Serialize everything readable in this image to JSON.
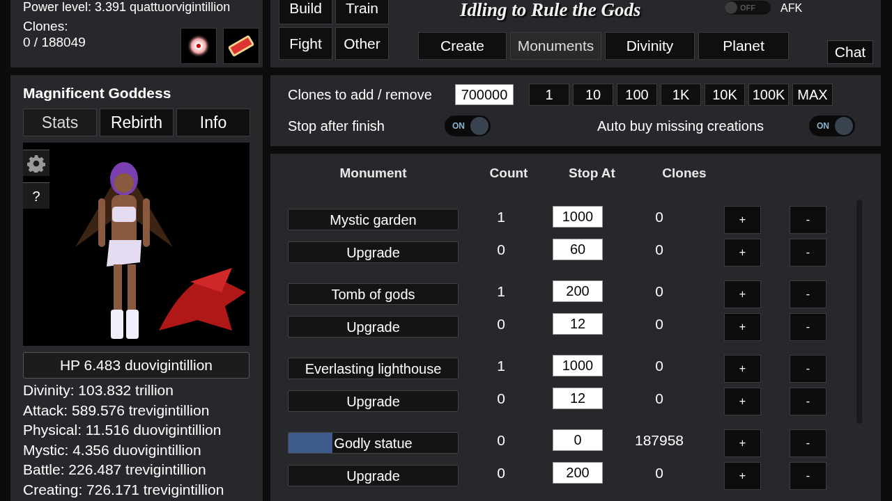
{
  "player": {
    "power_level": "Power level: 3.391 quattuorvigintillion",
    "clones_label": "Clones:",
    "clones_value": "0 / 188049"
  },
  "nav_buttons": [
    {
      "label": "Build"
    },
    {
      "label": "Train"
    },
    {
      "label": "Fight"
    },
    {
      "label": "Other"
    }
  ],
  "game_title": "Idling to Rule the Gods",
  "afk": {
    "toggle_text": "OFF",
    "on": false,
    "label": "AFK"
  },
  "tabs": [
    {
      "label": "Create",
      "selected": false
    },
    {
      "label": "Monuments",
      "selected": true
    },
    {
      "label": "Divinity",
      "selected": false
    },
    {
      "label": "Planet",
      "selected": false
    }
  ],
  "chat_button": "Chat",
  "character": {
    "name": "Magnificent Goddess",
    "tabs": [
      {
        "label": "Stats",
        "selected": true
      },
      {
        "label": "Rebirth",
        "selected": false
      },
      {
        "label": "Info",
        "selected": false
      }
    ],
    "help_button": "?",
    "hp": "HP 6.483 duovigintillion",
    "stats": [
      "Divinity: 103.832 trillion",
      "Attack: 589.576 trevigintillion",
      "Physical: 11.516 duovigintillion",
      "Mystic: 4.356 duovigintillion",
      "Battle: 226.487 trevigintillion",
      "Creating: 726.171 trevigintillion"
    ]
  },
  "options": {
    "clones_label": "Clones to add / remove",
    "clones_value": "700000",
    "amount_buttons": [
      "1",
      "10",
      "100",
      "1K",
      "10K",
      "100K",
      "MAX"
    ],
    "toggles": [
      {
        "label": "Stop after finish",
        "text": "ON",
        "on": true
      },
      {
        "label": "Auto buy missing creations",
        "text": "ON",
        "on": true
      }
    ]
  },
  "table": {
    "columns": [
      "Monument",
      "Count",
      "Stop At",
      "Clones"
    ],
    "groups": [
      {
        "rows": [
          {
            "name": "Mystic garden",
            "count": "1",
            "stop_at": "1000",
            "clones": "0",
            "plus": "+",
            "minus": "-"
          },
          {
            "name": "Upgrade",
            "count": "0",
            "stop_at": "60",
            "clones": "0",
            "plus": "+",
            "minus": "-"
          }
        ]
      },
      {
        "rows": [
          {
            "name": "Tomb of gods",
            "count": "1",
            "stop_at": "200",
            "clones": "0",
            "plus": "+",
            "minus": "-"
          },
          {
            "name": "Upgrade",
            "count": "0",
            "stop_at": "12",
            "clones": "0",
            "plus": "+",
            "minus": "-"
          }
        ]
      },
      {
        "rows": [
          {
            "name": "Everlasting lighthouse",
            "count": "1",
            "stop_at": "1000",
            "clones": "0",
            "plus": "+",
            "minus": "-"
          },
          {
            "name": "Upgrade",
            "count": "0",
            "stop_at": "12",
            "clones": "0",
            "plus": "+",
            "minus": "-"
          }
        ]
      },
      {
        "rows": [
          {
            "name": "Godly statue",
            "level": 0.26,
            "count": "0",
            "stop_at": "0",
            "clones": "187958",
            "plus": "+",
            "minus": "-"
          },
          {
            "name": "Upgrade",
            "count": "0",
            "stop_at": "200",
            "clones": "0",
            "plus": "+",
            "minus": "-"
          }
        ]
      }
    ]
  }
}
